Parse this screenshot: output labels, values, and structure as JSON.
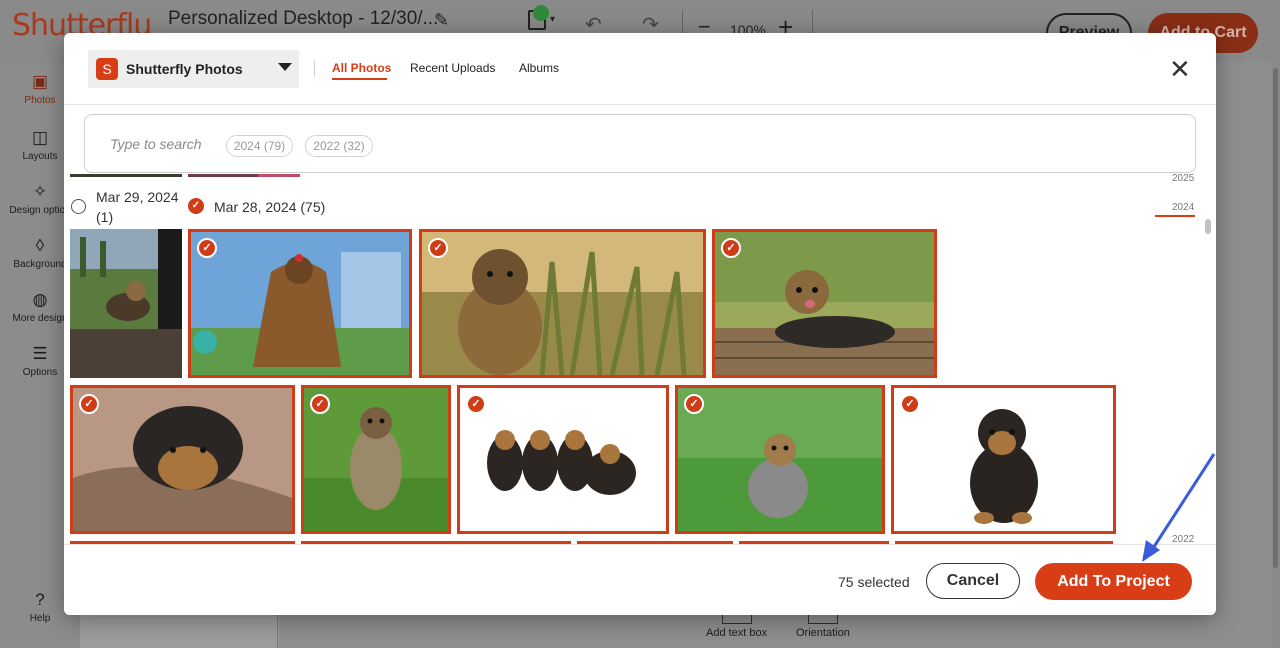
{
  "app": {
    "logo": "Shutterflu",
    "doc_title": "Personalized Desktop - 12/30/...",
    "zoom": "100%",
    "preview_label": "Preview",
    "add_to_cart_label": "Add to Cart",
    "nav": [
      {
        "label": "Photos",
        "icon": "image-icon"
      },
      {
        "label": "Layouts",
        "icon": "layout-icon"
      },
      {
        "label": "Design option",
        "icon": "sparkle-icon"
      },
      {
        "label": "Background",
        "icon": "drop-icon"
      },
      {
        "label": "More design",
        "icon": "palette-icon"
      },
      {
        "label": "Options",
        "icon": "list-icon"
      }
    ],
    "help_label": "Help",
    "bottom_tools": [
      "Add text box",
      "Orientation"
    ]
  },
  "modal": {
    "source": {
      "logo_letter": "S",
      "name": "Shutterfly Photos"
    },
    "tabs": [
      "All Photos",
      "Recent Uploads",
      "Albums"
    ],
    "active_tab": "All Photos",
    "search": {
      "placeholder": "Type to search"
    },
    "year_chips": [
      "2024 (79)",
      "2022 (32)"
    ],
    "timeline_years": [
      "2025",
      "2024",
      "2022"
    ],
    "groups": [
      {
        "date": "Mar 29, 2024",
        "count": "(1)",
        "selected": false
      },
      {
        "date": "Mar 28, 2024 (75)",
        "selected": true
      }
    ],
    "photos_row1": [
      "Yorkie on couch by window",
      "Long-haired Yorkie with bow",
      "Yorkie in tall grass",
      "Yorkie lying on wooden boards"
    ],
    "photos_row2": [
      "Yorkie puppy on cushion",
      "Yorkie running on grass",
      "Four Yorkie puppies",
      "Yorkie sitting on lawn",
      "Yorkie puppy on white"
    ],
    "selected_count": "75 selected",
    "cancel_label": "Cancel",
    "add_label": "Add To Project"
  },
  "colors": {
    "brand": "#d83d16",
    "annotation_arrow": "#3b5bdb"
  }
}
